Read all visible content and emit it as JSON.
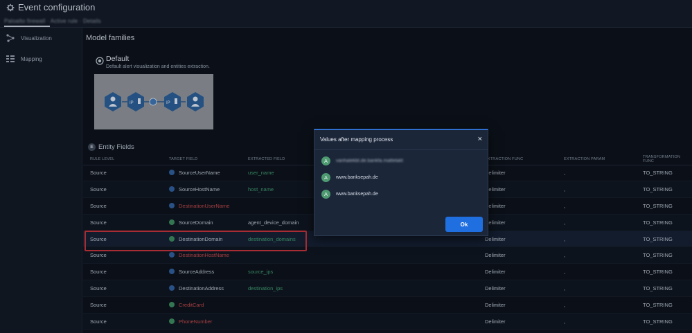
{
  "header": {
    "title": "Event configuration",
    "breadcrumb": "Paloalto firewall · Active rule · Details"
  },
  "sidebar": {
    "items": [
      {
        "label": "Visualization",
        "icon": "visualization-icon"
      },
      {
        "label": "Mapping",
        "icon": "mapping-icon"
      }
    ]
  },
  "main": {
    "heading": "Model families",
    "card": {
      "title": "Default",
      "description": "Default alert visualization and entities extraction.",
      "thumbnail_labels": [
        "IP",
        "IP"
      ]
    },
    "entity_fields": {
      "badge": "E",
      "title": "Entity Fields",
      "columns": [
        "RULE LEVEL",
        "TARGET FIELD",
        "EXTRACTED FIELD",
        "",
        "",
        "EXTRACTION FUNC",
        "EXTRACTION PARAM",
        "TRANSFORMATION FUNC"
      ],
      "rows": [
        {
          "rule": "Source",
          "target": "SourceUserName",
          "target_style": "normal",
          "icon": "blue",
          "extracted": "user_name",
          "extracted_style": "green",
          "func": "Delimiter",
          "param": ",",
          "transform": "TO_STRING"
        },
        {
          "rule": "Source",
          "target": "SourceHostName",
          "target_style": "normal",
          "icon": "blue",
          "extracted": "host_name",
          "extracted_style": "green",
          "func": "Delimiter",
          "param": ",",
          "transform": "TO_STRING"
        },
        {
          "rule": "Source",
          "target": "DestinationUserName",
          "target_style": "red",
          "icon": "blue",
          "extracted": "",
          "extracted_style": "normal",
          "func": "Delimiter",
          "param": ",",
          "transform": "TO_STRING"
        },
        {
          "rule": "Source",
          "target": "SourceDomain",
          "target_style": "normal",
          "icon": "green",
          "extracted": "agent_device_domain",
          "extracted_style": "normal",
          "func": "Delimiter",
          "param": ",",
          "transform": "TO_STRING"
        },
        {
          "rule": "Source",
          "target": "DestinationDomain",
          "target_style": "normal",
          "icon": "green",
          "extracted": "destination_domains",
          "extracted_style": "green",
          "func": "Delimiter",
          "param": ",",
          "transform": "TO_STRING"
        },
        {
          "rule": "Source",
          "target": "DestinationHostName",
          "target_style": "red",
          "icon": "blue",
          "extracted": "",
          "extracted_style": "normal",
          "func": "Delimiter",
          "param": ",",
          "transform": "TO_STRING"
        },
        {
          "rule": "Source",
          "target": "SourceAddress",
          "target_style": "normal",
          "icon": "blue",
          "extracted": "source_ips",
          "extracted_style": "green",
          "func": "Delimiter",
          "param": ",",
          "transform": "TO_STRING"
        },
        {
          "rule": "Source",
          "target": "DestinationAddress",
          "target_style": "normal",
          "icon": "blue",
          "extracted": "destination_ips",
          "extracted_style": "green",
          "func": "Delimiter",
          "param": ",",
          "transform": "TO_STRING"
        },
        {
          "rule": "Source",
          "target": "CreditCard",
          "target_style": "red",
          "icon": "green",
          "extracted": "",
          "extracted_style": "normal",
          "func": "Delimiter",
          "param": ",",
          "transform": "TO_STRING"
        },
        {
          "rule": "Source",
          "target": "PhoneNumber",
          "target_style": "red",
          "icon": "green",
          "extracted": "",
          "extracted_style": "normal",
          "func": "Delimiter",
          "param": ",",
          "transform": "TO_STRING"
        }
      ]
    }
  },
  "modal": {
    "title": "Values after mapping process",
    "close_label": "×",
    "items": [
      {
        "avatar": "A",
        "value": "vanhalekbt.de.bankfa.mattelakt",
        "redacted": true
      },
      {
        "avatar": "A",
        "value": "www.banksepah.de",
        "redacted": false
      },
      {
        "avatar": "A",
        "value": "www.banksepah.de",
        "redacted": false
      }
    ],
    "ok_label": "Ok"
  },
  "colors": {
    "accent": "#1f6fe0",
    "highlight_border": "#c4333a",
    "missing_field": "#c0484a",
    "extracted_field": "#3f9a6e"
  }
}
